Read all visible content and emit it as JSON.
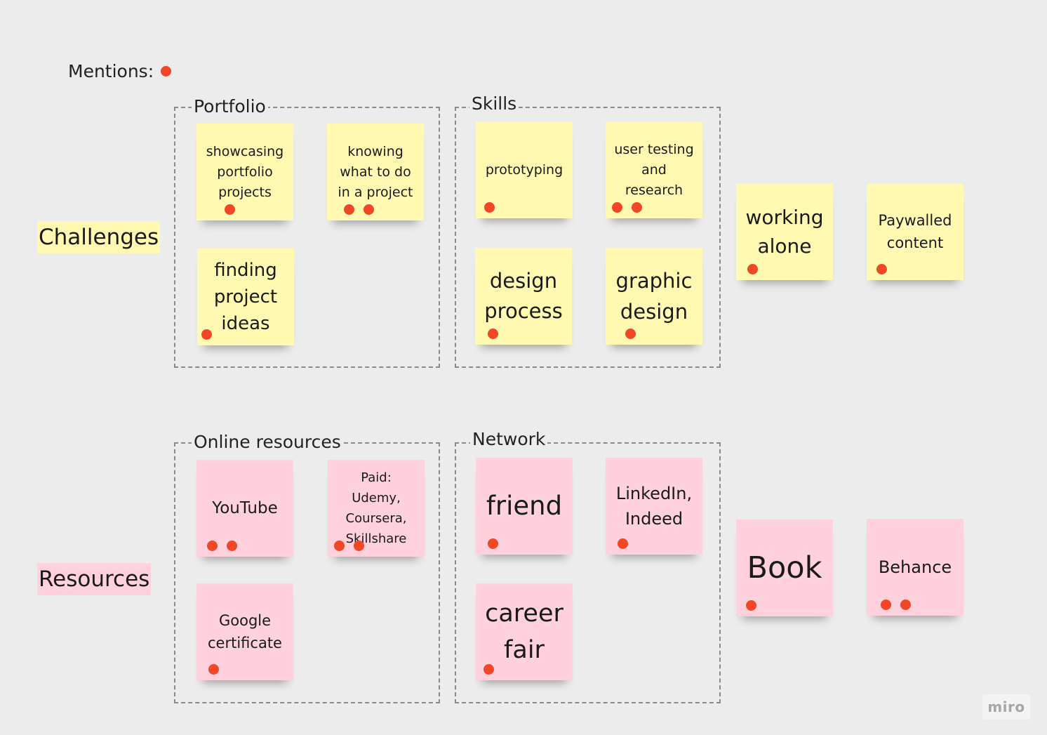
{
  "legend": {
    "label": "Mentions:"
  },
  "colors": {
    "yellow_note": "#fff9b1",
    "pink_note": "#ffd1dc",
    "dot": "#f24726",
    "canvas": "#ececec"
  },
  "rows": [
    {
      "label": "Challenges",
      "color": "#fff9b1"
    },
    {
      "label": "Resources",
      "color": "#ffd1dc"
    }
  ],
  "frames": [
    {
      "title": "Portfolio"
    },
    {
      "title": "Skills"
    },
    {
      "title": "Online resources"
    },
    {
      "title": "Network"
    }
  ],
  "notes": [
    {
      "text": "showcasing\nportfolio\nprojects",
      "mentions": 1,
      "color": "yellow"
    },
    {
      "text": "knowing\nwhat to do\nin a project",
      "mentions": 2,
      "color": "yellow"
    },
    {
      "text": "finding\nproject\nideas",
      "mentions": 1,
      "color": "yellow"
    },
    {
      "text": "prototyping",
      "mentions": 1,
      "color": "yellow"
    },
    {
      "text": "user testing\nand\nresearch",
      "mentions": 2,
      "color": "yellow"
    },
    {
      "text": "design\nprocess",
      "mentions": 1,
      "color": "yellow"
    },
    {
      "text": "graphic\ndesign",
      "mentions": 1,
      "color": "yellow"
    },
    {
      "text": "working\nalone",
      "mentions": 1,
      "color": "yellow"
    },
    {
      "text": "Paywalled\ncontent",
      "mentions": 1,
      "color": "yellow"
    },
    {
      "text": "YouTube",
      "mentions": 2,
      "color": "pink"
    },
    {
      "text": "Paid:\nUdemy,\nCoursera,\nSkillshare",
      "mentions": 2,
      "color": "pink"
    },
    {
      "text": "Google\ncertificate",
      "mentions": 1,
      "color": "pink"
    },
    {
      "text": "friend",
      "mentions": 1,
      "color": "pink"
    },
    {
      "text": "LinkedIn,\nIndeed",
      "mentions": 1,
      "color": "pink"
    },
    {
      "text": "career\nfair",
      "mentions": 1,
      "color": "pink"
    },
    {
      "text": "Book",
      "mentions": 1,
      "color": "pink"
    },
    {
      "text": "Behance",
      "mentions": 2,
      "color": "pink"
    }
  ],
  "watermark": {
    "text": "miro"
  }
}
